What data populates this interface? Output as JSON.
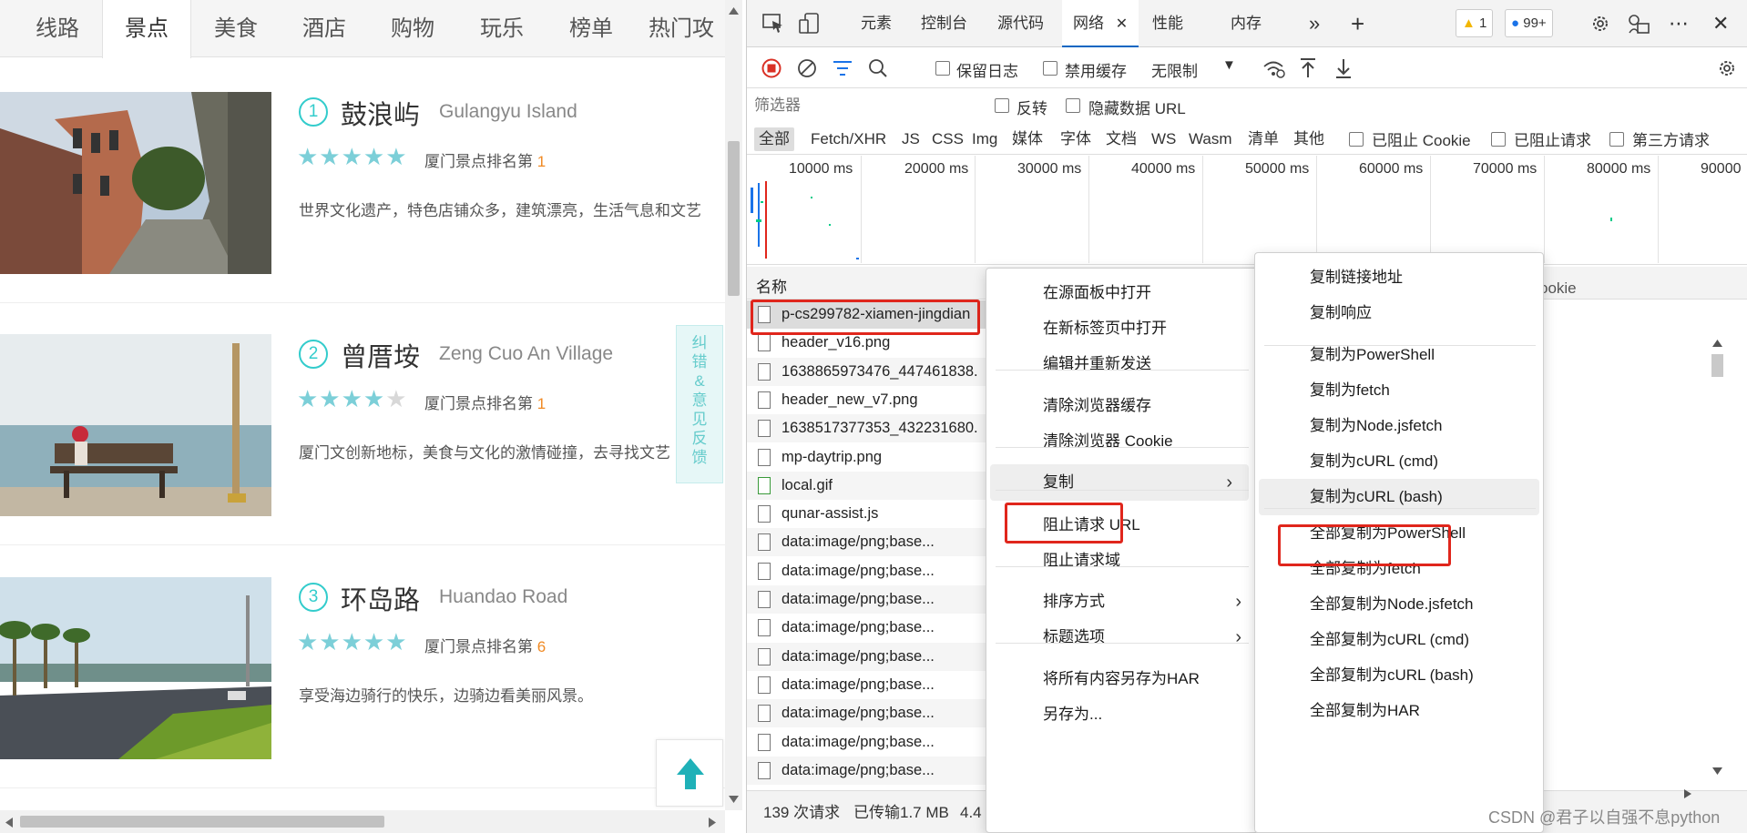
{
  "left": {
    "nav_tabs": [
      "线路",
      "景点",
      "美食",
      "酒店",
      "购物",
      "玩乐",
      "榜单",
      "热门攻略"
    ],
    "active_tab": "景点",
    "spots": [
      {
        "rank": "1",
        "name": "鼓浪屿",
        "en": "Gulangyu Island",
        "rating": 4.5,
        "rank_label": "厦门景点排名第",
        "rank_num": "1",
        "desc": "世界文化遗产，特色店铺众多，建筑漂亮，生活气息和文艺"
      },
      {
        "rank": "2",
        "name": "曾厝垵",
        "en": "Zeng Cuo An Village",
        "rating": 4,
        "rank_label": "厦门景点排名第",
        "rank_num": "1",
        "desc": "厦门文创新地标，美食与文化的激情碰撞，去寻找文艺"
      },
      {
        "rank": "3",
        "name": "环岛路",
        "en": "Huandao Road",
        "rating": 4.5,
        "rank_label": "厦门景点排名第",
        "rank_num": "6",
        "desc": "享受海边骑行的快乐，边骑边看美丽风景。"
      }
    ],
    "feedback_text": "纠错&意见反馈",
    "accent_color": "#33cccc",
    "rank_color": "#f08a24"
  },
  "devtools": {
    "tabs": [
      "元素",
      "控制台",
      "源代码",
      "网络",
      "性能",
      "内存"
    ],
    "active_tab": "网络",
    "warnings_count": "1",
    "messages_count": "99+",
    "toolbar": {
      "preserve_log": "保留日志",
      "disable_cache": "禁用缓存",
      "throttle": "无限制"
    },
    "filter_placeholder": "筛选器",
    "filter_options": {
      "invert": "反转",
      "hide_data_url": "隐藏数据 URL"
    },
    "types": [
      "全部",
      "Fetch/XHR",
      "JS",
      "CSS",
      "Img",
      "媒体",
      "字体",
      "文档",
      "WS",
      "Wasm",
      "清单",
      "其他"
    ],
    "type_checks": [
      "已阻止 Cookie",
      "已阻止请求",
      "第三方请求"
    ],
    "timeline_ticks": [
      "10000 ms",
      "20000 ms",
      "30000 ms",
      "40000 ms",
      "50000 ms",
      "60000 ms",
      "70000 ms",
      "80000 ms",
      "90000"
    ],
    "column_name": "名称",
    "column_cookie_partial": "ookie",
    "requests": [
      "p-cs299782-xiamen-jingdian",
      "header_v16.png",
      "1638865973476_447461838.",
      "header_new_v7.png",
      "1638517377353_432231680.",
      "mp-daytrip.png",
      "local.gif",
      "qunar-assist.js",
      "data:image/png;base...",
      "data:image/png;base...",
      "data:image/png;base...",
      "data:image/png;base...",
      "data:image/png;base...",
      "data:image/png;base...",
      "data:image/png;base...",
      "data:image/png;base...",
      "data:image/png;base..."
    ],
    "status": {
      "requests": "139 次请求",
      "transferred": "已传输1.7 MB",
      "resources_partial": "4.4"
    }
  },
  "context_menu": {
    "items": [
      {
        "label": "在源面板中打开"
      },
      {
        "label": "在新标签页中打开"
      },
      {
        "label": "编辑并重新发送"
      },
      {
        "label": "清除浏览器缓存"
      },
      {
        "label": "清除浏览器 Cookie"
      },
      {
        "label": "复制",
        "submenu": true
      },
      {
        "label": "阻止请求 URL"
      },
      {
        "label": "阻止请求域"
      },
      {
        "label": "排序方式",
        "submenu": true
      },
      {
        "label": "标题选项",
        "submenu": true
      },
      {
        "label": "将所有内容另存为HAR"
      },
      {
        "label": "另存为..."
      }
    ]
  },
  "copy_submenu": {
    "items": [
      "复制链接地址",
      "复制响应",
      "复制为PowerShell",
      "复制为fetch",
      "复制为Node.jsfetch",
      "复制为cURL (cmd)",
      "复制为cURL (bash)",
      "全部复制为PowerShell",
      "全部复制为fetch",
      "全部复制为Node.jsfetch",
      "全部复制为cURL (cmd)",
      "全部复制为cURL (bash)",
      "全部复制为HAR"
    ],
    "highlighted": "复制为cURL (bash)"
  },
  "watermark": "CSDN @君子以自强不息python",
  "highlight_color": "#e0261c"
}
